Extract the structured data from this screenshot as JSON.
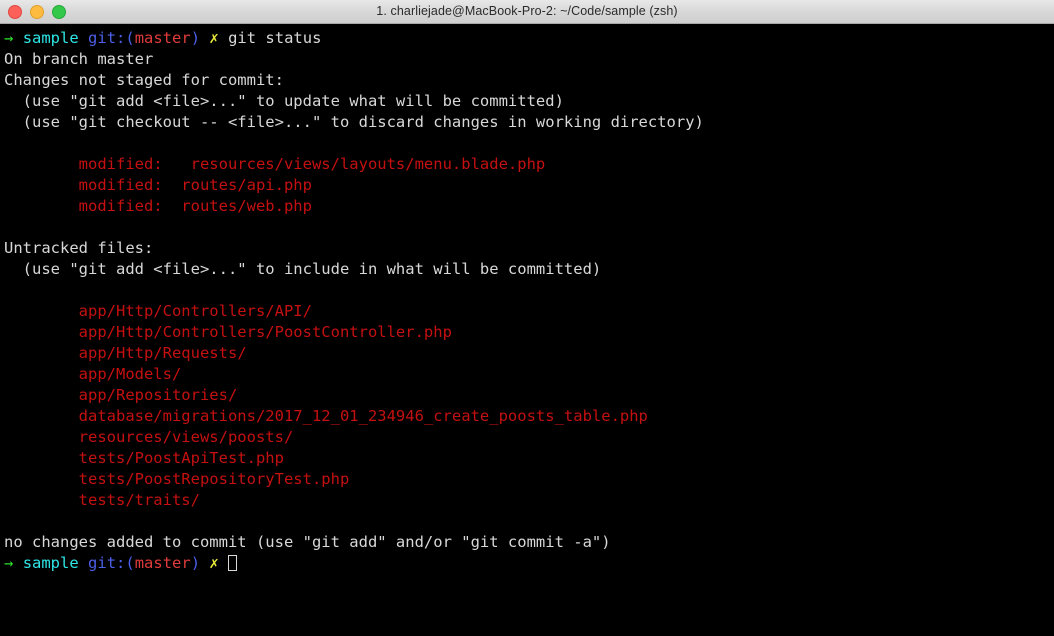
{
  "window": {
    "title": "1. charliejade@MacBook-Pro-2: ~/Code/sample (zsh)",
    "traffic_lights": {
      "close": "close-button",
      "minimize": "minimize-button",
      "zoom": "zoom-button"
    }
  },
  "colors": {
    "background": "#000000",
    "foreground": "#d8d8d8",
    "green": "#2ee32e",
    "cyan": "#2ee6e6",
    "blue": "#4c5fe8",
    "bright_red": "#e03b3b",
    "yellow": "#eaea3a",
    "red": "#c51010",
    "titlebar": "#d8d8d8"
  },
  "prompt": {
    "arrow": "→",
    "dir": "sample",
    "git_open": "git:(",
    "branch": "master",
    "git_close": ")",
    "dirty_mark": "✗"
  },
  "commands": {
    "entered": "git status"
  },
  "output": {
    "branch_line": "On branch master",
    "not_staged_header": "Changes not staged for commit:",
    "hint_add_update": "  (use \"git add <file>...\" to update what will be committed)",
    "hint_checkout_discard": "  (use \"git checkout -- <file>...\" to discard changes in working directory)",
    "modified": [
      {
        "label": "        modified:",
        "path": "   resources/views/layouts/menu.blade.php"
      },
      {
        "label": "        modified:",
        "path": "  routes/api.php"
      },
      {
        "label": "        modified:",
        "path": "  routes/web.php"
      }
    ],
    "untracked_header": "Untracked files:",
    "hint_add_include": "  (use \"git add <file>...\" to include in what will be committed)",
    "untracked": [
      "        app/Http/Controllers/API/",
      "        app/Http/Controllers/PoostController.php",
      "        app/Http/Requests/",
      "        app/Models/",
      "        app/Repositories/",
      "        database/migrations/2017_12_01_234946_create_poosts_table.php",
      "        resources/views/poosts/",
      "        tests/PoostApiTest.php",
      "        tests/PoostRepositoryTest.php",
      "        tests/traits/"
    ],
    "footer": "no changes added to commit (use \"git add\" and/or \"git commit -a\")"
  }
}
